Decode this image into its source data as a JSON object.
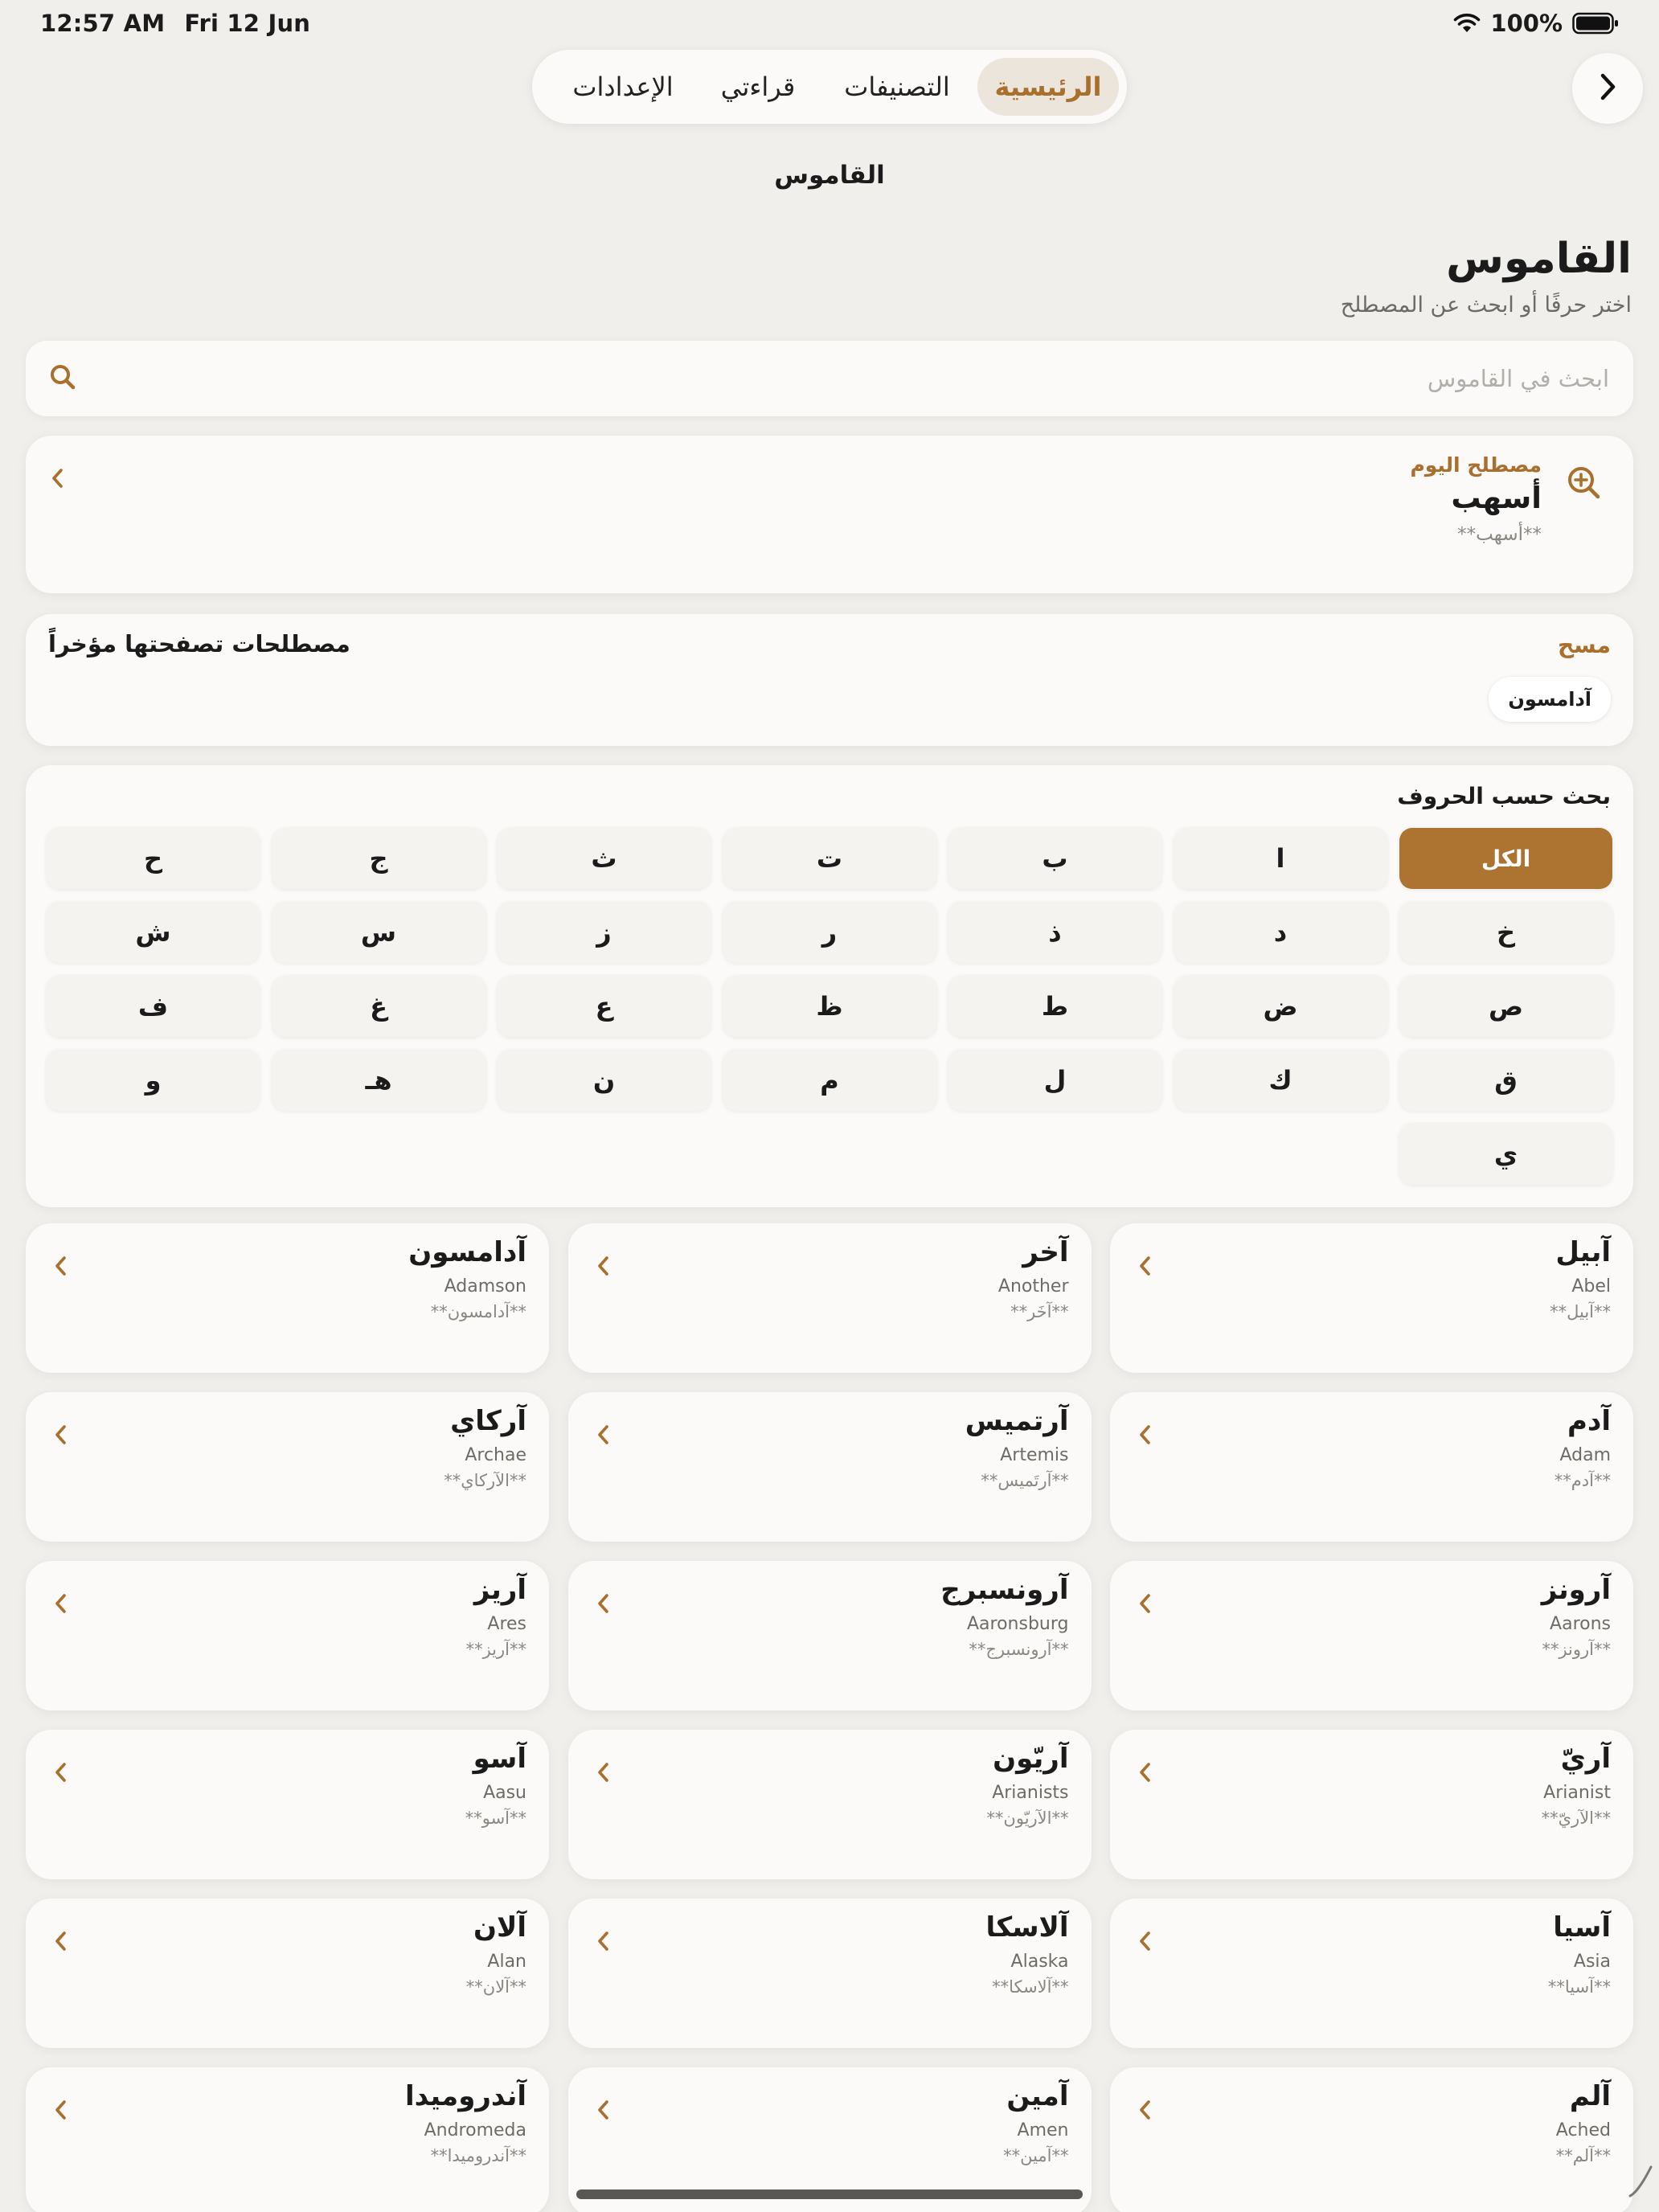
{
  "status": {
    "time": "12:57 AM",
    "date": "Fri 12 Jun",
    "battery": "100%"
  },
  "tabs": [
    {
      "label": "الرئيسية",
      "active": true
    },
    {
      "label": "التصنيفات",
      "active": false
    },
    {
      "label": "قراءتي",
      "active": false
    },
    {
      "label": "الإعدادات",
      "active": false
    }
  ],
  "nav_title": "القاموس",
  "header": {
    "title": "القاموس",
    "subtitle": "اختر حرفًا أو ابحث عن المصطلح"
  },
  "search": {
    "placeholder": "ابحث في القاموس",
    "value": ""
  },
  "term_of_day": {
    "label": "مصطلح اليوم",
    "term": "أسهب",
    "definition": "**أسهب**"
  },
  "recent": {
    "title": "مصطلحات تصفحتها مؤخراً",
    "clear_label": "مسح",
    "items": [
      "آدامسون"
    ]
  },
  "letters": {
    "title": "بحث حسب الحروف",
    "items": [
      "الكل",
      "ا",
      "ب",
      "ت",
      "ث",
      "ج",
      "ح",
      "خ",
      "د",
      "ذ",
      "ر",
      "ز",
      "س",
      "ش",
      "ص",
      "ض",
      "ط",
      "ظ",
      "ع",
      "غ",
      "ف",
      "ق",
      "ك",
      "ل",
      "م",
      "ن",
      "هـ",
      "و",
      "ي"
    ],
    "selected": "الكل"
  },
  "terms": [
    {
      "ar": "آبيل",
      "en": "Abel",
      "def": "**آبيل**"
    },
    {
      "ar": "آخر",
      "en": "Another",
      "def": "**آخَر**"
    },
    {
      "ar": "آدامسون",
      "en": "Adamson",
      "def": "**آدامسون**"
    },
    {
      "ar": "آدم",
      "en": "Adam",
      "def": "**آدم**"
    },
    {
      "ar": "آرتميس",
      "en": "Artemis",
      "def": "**آرتَميس**"
    },
    {
      "ar": "آركاي",
      "en": "Archae",
      "def": "**الآركاي**"
    },
    {
      "ar": "آرونز",
      "en": "Aarons",
      "def": "**آرونز**"
    },
    {
      "ar": "آرونسبرج",
      "en": "Aaronsburg",
      "def": "**آرونسبرج**"
    },
    {
      "ar": "آريز",
      "en": "Ares",
      "def": "**آريز**"
    },
    {
      "ar": "آريّ",
      "en": "Arianist",
      "def": "**الآريّ**"
    },
    {
      "ar": "آريّون",
      "en": "Arianists",
      "def": "**الآريّون**"
    },
    {
      "ar": "آسو",
      "en": "Aasu",
      "def": "**آسو**"
    },
    {
      "ar": "آسيا",
      "en": "Asia",
      "def": "**آسيا**"
    },
    {
      "ar": "آلاسكا",
      "en": "Alaska",
      "def": "**آلاسكا**"
    },
    {
      "ar": "آلان",
      "en": "Alan",
      "def": "**آلان**"
    },
    {
      "ar": "آلم",
      "en": "Ached",
      "def": "**آلم**"
    },
    {
      "ar": "آمين",
      "en": "Amen",
      "def": "**آمين**"
    },
    {
      "ar": "آندروميدا",
      "en": "Andromeda",
      "def": "**آندروميدا**"
    }
  ],
  "colors": {
    "accent": "#ad7330",
    "background": "#f1efeb",
    "card": "#fbfaf8"
  },
  "icons": {
    "back": "chevron-right-icon",
    "search": "search-icon",
    "zoom": "zoom-in-icon",
    "row": "chevron-left-icon"
  }
}
